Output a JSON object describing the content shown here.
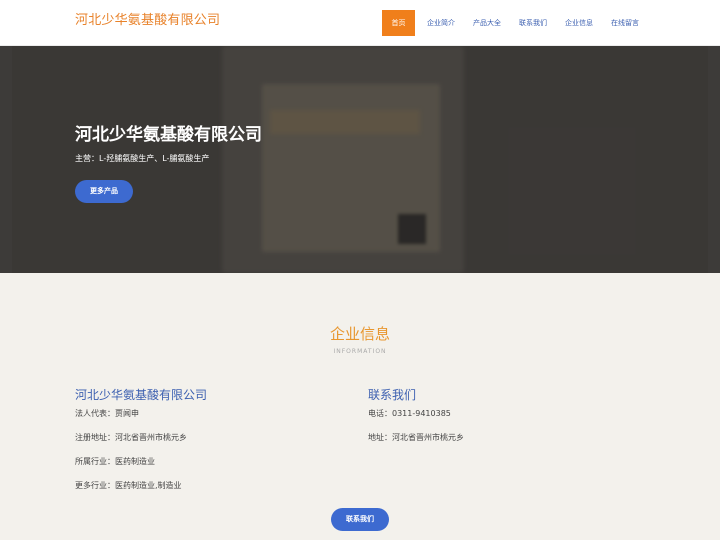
{
  "header": {
    "logo": "河北少华氨基酸有限公司",
    "nav": [
      "首页",
      "企业简介",
      "产品大全",
      "联系我们",
      "企业信息",
      "在线留言"
    ]
  },
  "hero": {
    "title": "河北少华氨基酸有限公司",
    "subtitle": "主营：L-羟脯氨酸生产、L-脯氨酸生产",
    "button": "更多产品"
  },
  "info_section": {
    "title": "企业信息",
    "subtitle": "INFORMATION",
    "left_heading": "河北少华氨基酸有限公司",
    "left_items": [
      "法人代表：贾闻申",
      "注册地址：河北省晋州市桃元乡",
      "所属行业：医药制造业",
      "更多行业：医药制造业,制造业"
    ],
    "right_heading": "联系我们",
    "right_items": [
      "电话：0311-9410385",
      "地址：河北省晋州市桃元乡"
    ],
    "contact_button": "联系我们"
  },
  "colors": {
    "accent_orange": "#f07f1b",
    "link_blue": "#3b5fb0",
    "button_blue": "#3d6ad0"
  }
}
